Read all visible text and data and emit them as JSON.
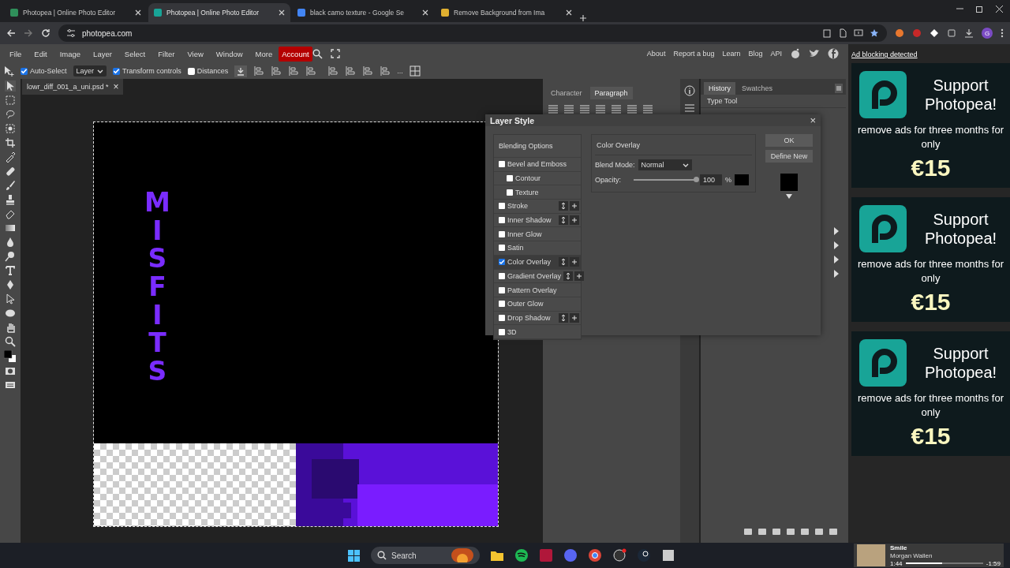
{
  "browser": {
    "tabs": [
      {
        "title": "Photopea | Online Photo Editor",
        "selected": false
      },
      {
        "title": "Photopea | Online Photo Editor",
        "selected": true
      },
      {
        "title": "black camo texture - Google Se",
        "selected": false
      },
      {
        "title": "Remove Background from Ima",
        "selected": false
      }
    ],
    "url": "photopea.com",
    "profile": "G"
  },
  "menu": [
    {
      "label": "File",
      "kind": "item"
    },
    {
      "label": "Edit",
      "kind": "item"
    },
    {
      "label": "Image",
      "kind": "item"
    },
    {
      "label": "Layer",
      "kind": "item"
    },
    {
      "label": "Select",
      "kind": "item"
    },
    {
      "label": "Filter",
      "kind": "item"
    },
    {
      "label": "View",
      "kind": "item"
    },
    {
      "label": "Window",
      "kind": "item"
    },
    {
      "label": "More",
      "kind": "item"
    },
    {
      "label": "Account",
      "kind": "account"
    }
  ],
  "links": [
    "About",
    "Report a bug",
    "Learn",
    "Blog",
    "API"
  ],
  "options_bar": {
    "auto_select": {
      "label": "Auto-Select",
      "checked": true
    },
    "target": "Layer",
    "transform_controls": {
      "label": "Transform controls",
      "checked": true
    },
    "distances": {
      "label": "Distances",
      "checked": false
    },
    "more": "..."
  },
  "document_tab": {
    "title": "lowr_diff_001_a_uni.psd *",
    "close": "×"
  },
  "canvas": {
    "vertical_text": "MISFITS"
  },
  "panels": {
    "text_tabs": [
      {
        "label": "Character",
        "selected": false
      },
      {
        "label": "Paragraph",
        "selected": true
      }
    ],
    "history_tabs": [
      {
        "label": "History",
        "selected": true
      },
      {
        "label": "Swatches",
        "selected": false
      }
    ],
    "history": [
      "Type Tool"
    ]
  },
  "dialog": {
    "title": "Layer Style",
    "close": "×",
    "styles": [
      {
        "label": "Blending Options",
        "kind": "header",
        "selected": false
      },
      {
        "label": "Bevel and Emboss",
        "kind": "check",
        "checked": false,
        "buttons": false,
        "selected": false
      },
      {
        "label": "Contour",
        "kind": "sub",
        "checked": false,
        "buttons": false,
        "selected": false
      },
      {
        "label": "Texture",
        "kind": "sub",
        "checked": false,
        "buttons": false,
        "selected": false
      },
      {
        "label": "Stroke",
        "kind": "check",
        "checked": false,
        "buttons": true,
        "selected": false
      },
      {
        "label": "Inner Shadow",
        "kind": "check",
        "checked": false,
        "buttons": true,
        "selected": false
      },
      {
        "label": "Inner Glow",
        "kind": "check",
        "checked": false,
        "buttons": false,
        "selected": false
      },
      {
        "label": "Satin",
        "kind": "check",
        "checked": false,
        "buttons": false,
        "selected": false
      },
      {
        "label": "Color Overlay",
        "kind": "check",
        "checked": true,
        "buttons": true,
        "selected": true
      },
      {
        "label": "Gradient Overlay",
        "kind": "check",
        "checked": false,
        "buttons": true,
        "selected": false
      },
      {
        "label": "Pattern Overlay",
        "kind": "check",
        "checked": false,
        "buttons": false,
        "selected": false
      },
      {
        "label": "Outer Glow",
        "kind": "check",
        "checked": false,
        "buttons": false,
        "selected": false
      },
      {
        "label": "Drop Shadow",
        "kind": "check",
        "checked": false,
        "buttons": true,
        "selected": false
      },
      {
        "label": "3D",
        "kind": "check",
        "checked": false,
        "buttons": false,
        "selected": false
      }
    ],
    "section_title": "Color Overlay",
    "blend_mode_label": "Blend Mode:",
    "blend_mode": "Normal",
    "opacity_label": "Opacity:",
    "opacity": {
      "level": 1,
      "value": "100",
      "unit": "%"
    },
    "buttons": [
      "OK",
      "Define New"
    ]
  },
  "ad": {
    "notice": "Ad blocking detected",
    "cards": [
      {
        "title": "Support Photopea!",
        "text": "remove ads for three months for only",
        "price": "€15"
      },
      {
        "title": "Support Photopea!",
        "text": "remove ads for three months for only",
        "price": "€15"
      },
      {
        "title": "Support Photopea!",
        "text": "remove ads for three months for only",
        "price": "€15"
      }
    ]
  },
  "taskbar": {
    "search": "Search"
  },
  "media": {
    "title": "Smile",
    "artist": "Morgan Wallen",
    "elapsed": "1:44",
    "remaining": "-1:59",
    "level": 0.47
  }
}
